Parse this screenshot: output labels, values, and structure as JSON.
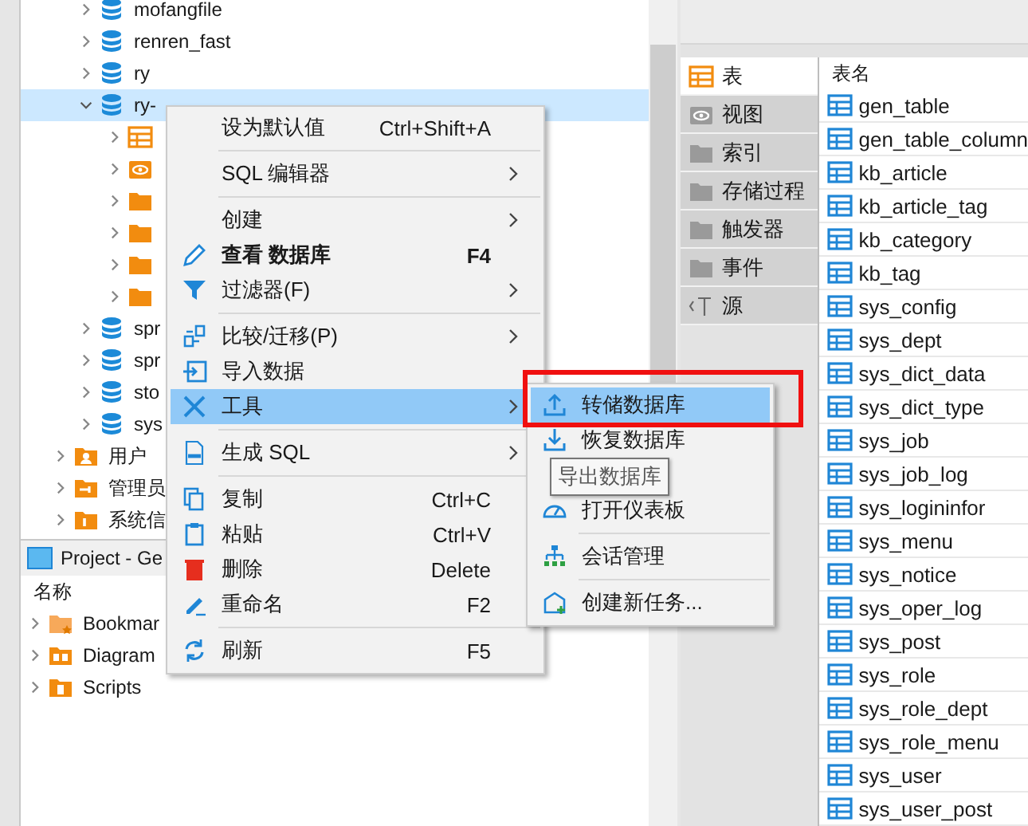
{
  "tree": {
    "databases": [
      {
        "label": "mofangfile",
        "expanded": false,
        "selected": false
      },
      {
        "label": "renren_fast",
        "expanded": false,
        "selected": false
      },
      {
        "label": "ry",
        "expanded": false,
        "selected": false
      },
      {
        "label": "ry-",
        "expanded": true,
        "selected": true,
        "children": [
          {
            "kind": "table"
          },
          {
            "kind": "view"
          },
          {
            "kind": "folder"
          },
          {
            "kind": "folder"
          },
          {
            "kind": "folder"
          },
          {
            "kind": "folder"
          }
        ]
      },
      {
        "label": "spr",
        "expanded": false,
        "selected": false
      },
      {
        "label": "spr",
        "expanded": false,
        "selected": false
      },
      {
        "label": "sto",
        "expanded": false,
        "selected": false
      },
      {
        "label": "sys",
        "expanded": false,
        "selected": false
      }
    ],
    "folders": [
      {
        "label": "用户",
        "kind": "user"
      },
      {
        "label": "管理员",
        "kind": "admin"
      },
      {
        "label": "系统信",
        "kind": "info"
      }
    ]
  },
  "project": {
    "title": "Project - Ge",
    "column": "名称",
    "items": [
      {
        "label": "Bookmar",
        "kind": "bookmarks"
      },
      {
        "label": "Diagram",
        "kind": "diagrams"
      },
      {
        "label": "Scripts",
        "kind": "scripts"
      }
    ]
  },
  "context_menu": [
    {
      "kind": "item",
      "label": "设为默认值",
      "shortcut": "Ctrl+Shift+A",
      "submenu": false,
      "bold": false,
      "selected": false
    },
    {
      "kind": "separator"
    },
    {
      "kind": "item",
      "label": "SQL 编辑器",
      "submenu": true,
      "bold": false,
      "selected": false
    },
    {
      "kind": "separator"
    },
    {
      "kind": "item",
      "label": "创建",
      "submenu": true,
      "bold": false,
      "selected": false
    },
    {
      "kind": "item",
      "label": "查看 数据库",
      "shortcut": "F4",
      "submenu": false,
      "bold": true,
      "selected": false
    },
    {
      "kind": "item",
      "label": "过滤器(F)",
      "submenu": true,
      "bold": false,
      "selected": false
    },
    {
      "kind": "separator"
    },
    {
      "kind": "item",
      "label": "比较/迁移(P)",
      "submenu": true,
      "bold": false,
      "selected": false
    },
    {
      "kind": "item",
      "label": "导入数据",
      "submenu": false,
      "bold": false,
      "selected": false
    },
    {
      "kind": "item",
      "label": "工具",
      "submenu": true,
      "bold": false,
      "selected": true
    },
    {
      "kind": "separator"
    },
    {
      "kind": "item",
      "label": "生成 SQL",
      "submenu": true,
      "bold": false,
      "selected": false
    },
    {
      "kind": "separator"
    },
    {
      "kind": "item",
      "label": "复制",
      "shortcut": "Ctrl+C",
      "submenu": false,
      "bold": false,
      "selected": false
    },
    {
      "kind": "item",
      "label": "粘贴",
      "shortcut": "Ctrl+V",
      "submenu": false,
      "bold": false,
      "selected": false
    },
    {
      "kind": "item",
      "label": "删除",
      "shortcut": "Delete",
      "submenu": false,
      "bold": false,
      "selected": false
    },
    {
      "kind": "item",
      "label": "重命名",
      "shortcut": "F2",
      "submenu": false,
      "bold": false,
      "selected": false
    },
    {
      "kind": "separator"
    },
    {
      "kind": "item",
      "label": "刷新",
      "shortcut": "F5",
      "submenu": false,
      "bold": false,
      "selected": false
    }
  ],
  "submenu": [
    {
      "kind": "item",
      "label": "转储数据库",
      "selected": true
    },
    {
      "kind": "item",
      "label": "恢复数据库",
      "selected": false
    },
    {
      "kind": "hidden"
    },
    {
      "kind": "item",
      "label": "打开仪表板",
      "selected": false
    },
    {
      "kind": "separator"
    },
    {
      "kind": "item",
      "label": "会话管理",
      "selected": false
    },
    {
      "kind": "separator"
    },
    {
      "kind": "item",
      "label": "创建新任务...",
      "selected": false
    }
  ],
  "tooltip": "导出数据库",
  "object_tabs": [
    {
      "label": "表",
      "selected": true
    },
    {
      "label": "视图",
      "selected": false
    },
    {
      "label": "索引",
      "selected": false
    },
    {
      "label": "存储过程",
      "selected": false
    },
    {
      "label": "触发器",
      "selected": false
    },
    {
      "label": "事件",
      "selected": false
    },
    {
      "label": "源",
      "selected": false
    }
  ],
  "tables": {
    "column": "表名",
    "rows": [
      "gen_table",
      "gen_table_column",
      "kb_article",
      "kb_article_tag",
      "kb_category",
      "kb_tag",
      "sys_config",
      "sys_dept",
      "sys_dict_data",
      "sys_dict_type",
      "sys_job",
      "sys_job_log",
      "sys_logininfor",
      "sys_menu",
      "sys_notice",
      "sys_oper_log",
      "sys_post",
      "sys_role",
      "sys_role_dept",
      "sys_role_menu",
      "sys_user",
      "sys_user_post"
    ]
  }
}
